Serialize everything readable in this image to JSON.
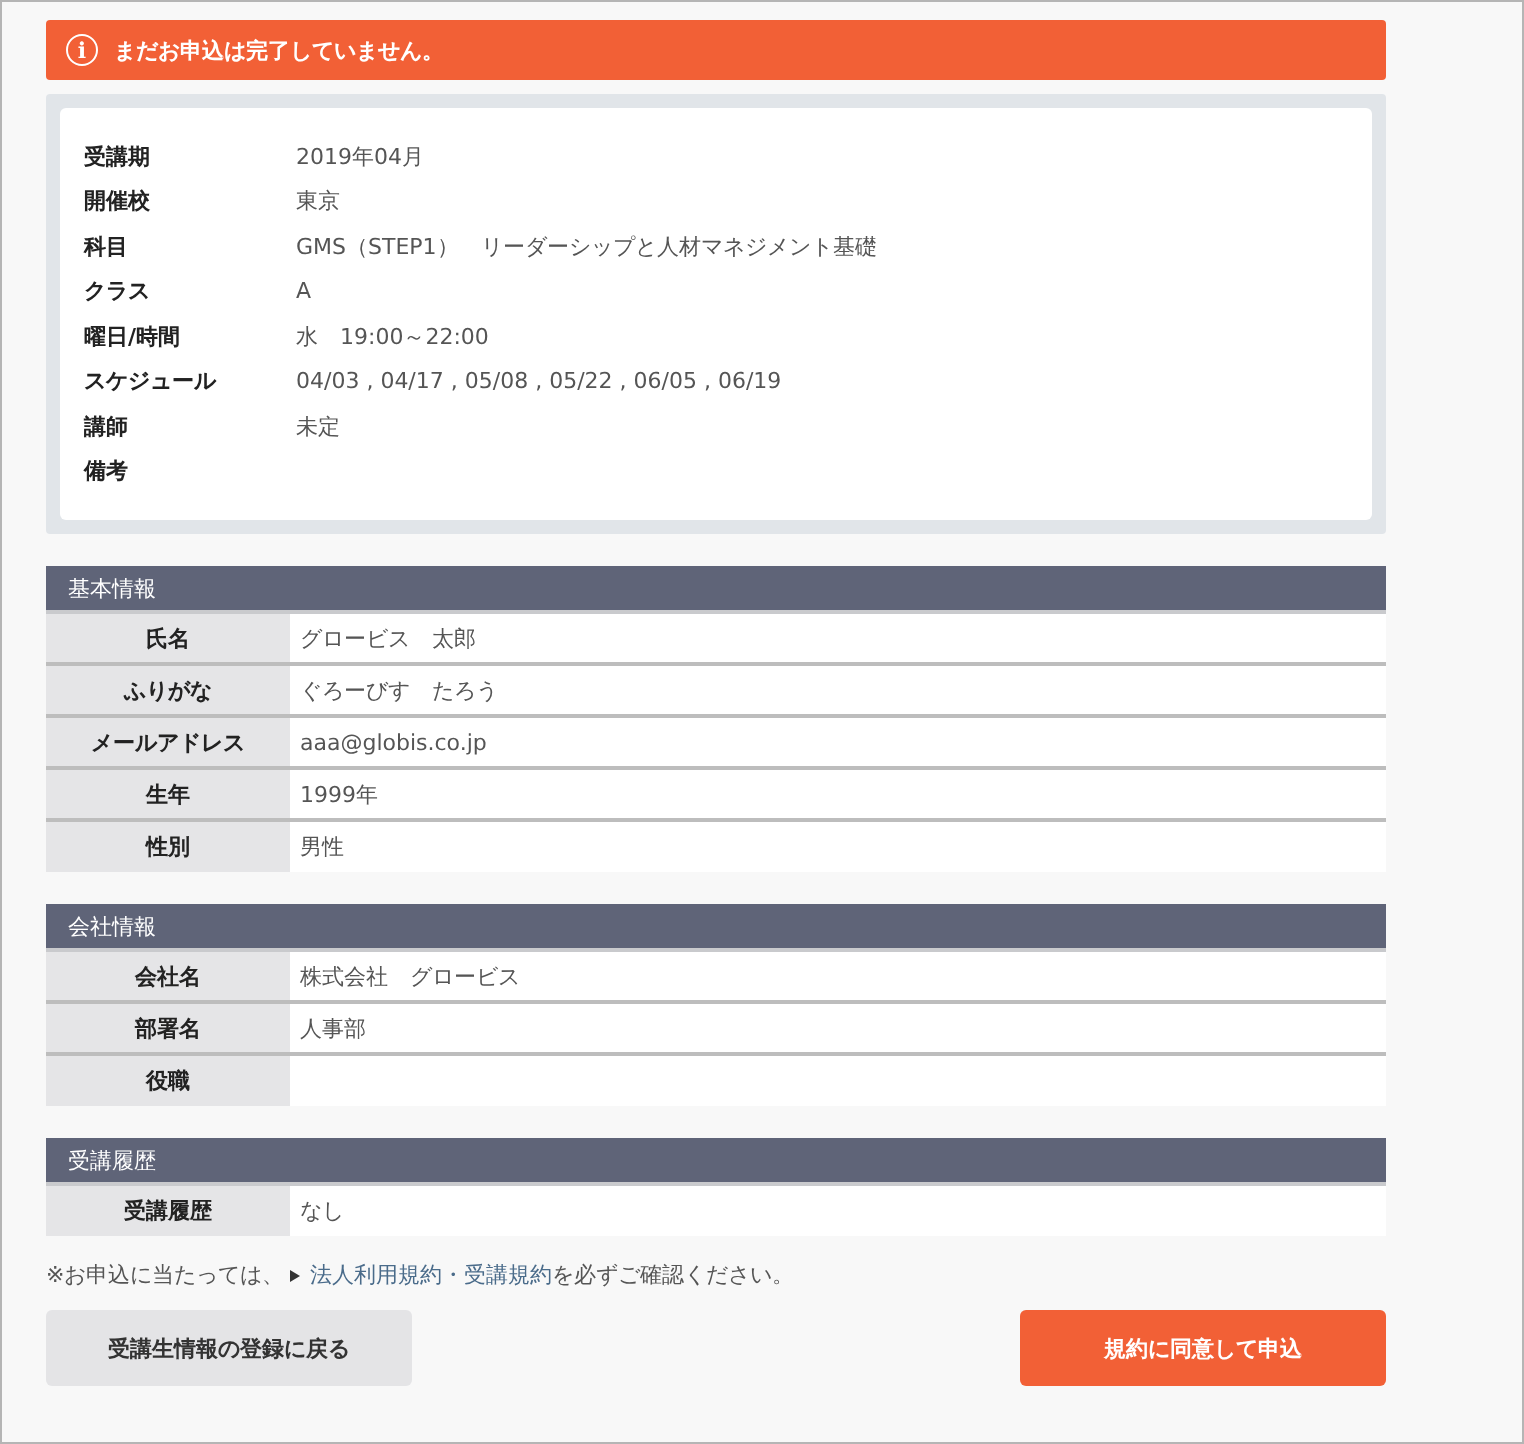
{
  "alert": {
    "icon": "i",
    "message": "まだお申込は完了していません。"
  },
  "summary": [
    {
      "label": "受講期",
      "value": "2019年04月"
    },
    {
      "label": "開催校",
      "value": "東京"
    },
    {
      "label": "科目",
      "value": "GMS（STEP1）　リーダーシップと人材マネジメント基礎"
    },
    {
      "label": "クラス",
      "value": "A"
    },
    {
      "label": "曜日/時間",
      "value": "水　19:00～22:00"
    },
    {
      "label": "スケジュール",
      "value": "04/03 , 04/17 , 05/08 , 05/22 , 06/05 , 06/19"
    },
    {
      "label": "講師",
      "value": "未定"
    },
    {
      "label": "備考"
    }
  ],
  "sections": [
    {
      "title": "基本情報",
      "rows": [
        {
          "label": "氏名",
          "value": "グロービス　太郎"
        },
        {
          "label": "ふりがな",
          "value": "ぐろーびす　たろう"
        },
        {
          "label": "メールアドレス",
          "value": "aaa@globis.co.jp"
        },
        {
          "label": "生年",
          "value": "1999年"
        },
        {
          "label": "性別",
          "value": "男性"
        }
      ]
    },
    {
      "title": "会社情報",
      "rows": [
        {
          "label": "会社名",
          "value": "株式会社　グロービス"
        },
        {
          "label": "部署名",
          "value": "人事部"
        },
        {
          "label": "役職"
        }
      ]
    },
    {
      "title": "受講履歴",
      "rows": [
        {
          "label": "受講履歴",
          "value": "なし"
        }
      ]
    }
  ],
  "notice": {
    "before": "※お申込に当たっては、",
    "link": "法人利用規約・受講規約",
    "after": "を必ずご確認ください。"
  },
  "buttons": [
    {
      "label": "受講生情報の登録に戻る",
      "kind": "secondary"
    },
    {
      "label": "規約に同意して申込",
      "kind": "primary"
    }
  ]
}
